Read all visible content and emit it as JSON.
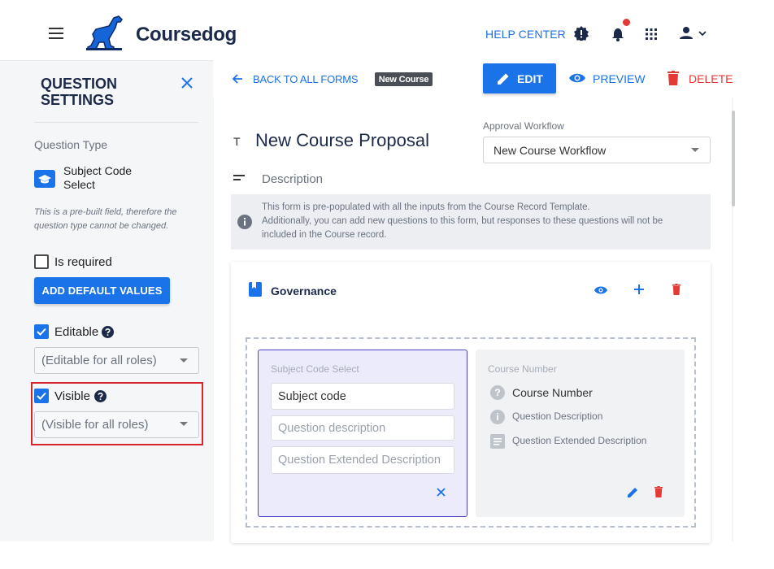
{
  "header": {
    "brand": "Coursedog",
    "help_center": "HELP CENTER",
    "colors": {
      "accent": "#1a73e8",
      "brand_dark": "#1c2a4a",
      "notify": "#e53935"
    }
  },
  "sidebar": {
    "title": "QUESTION SETTINGS",
    "question_type_label": "Question Type",
    "question_type_value": "Subject Code Select",
    "note": "This is a pre-built field, therefore the question type cannot be changed.",
    "is_required_label": "Is required",
    "add_default_values": "ADD DEFAULT VALUES",
    "editable_label": "Editable",
    "editable_select": "(Editable for all roles)",
    "visible_label": "Visible",
    "visible_select": "(Visible for all roles)"
  },
  "topbar": {
    "back": "BACK TO ALL FORMS",
    "chip": "New Course",
    "edit": "EDIT",
    "preview": "PREVIEW",
    "delete": "DELETE"
  },
  "form": {
    "title": "New Course Proposal",
    "approval_label": "Approval Workflow",
    "approval_value": "New Course Workflow",
    "description_label": "Description",
    "info_line1": "This form is pre-populated with all the inputs from the Course Record Template.",
    "info_line2": "Additionally, you can add new questions to this form, but responses to these questions will not be",
    "info_line3": "included in the Course record."
  },
  "governance": {
    "title": "Governance",
    "q1": {
      "header": "Subject Code Select",
      "value": "Subject code",
      "desc_placeholder": "Question description",
      "ext_placeholder": "Question Extended Description"
    },
    "q2": {
      "header": "Course Number",
      "label": "Course Number",
      "description": "Question Description",
      "extended": "Question Extended Description"
    }
  }
}
